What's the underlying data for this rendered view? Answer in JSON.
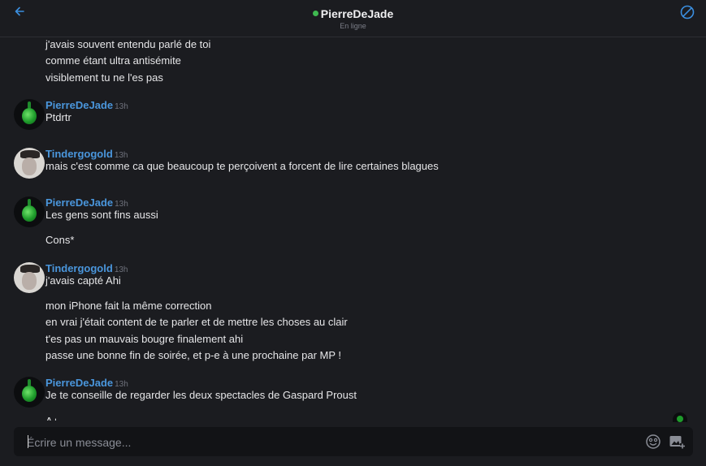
{
  "header": {
    "title": "PierreDeJade",
    "status": "En ligne",
    "status_color": "#3fb950",
    "back_icon": "arrow-left-icon",
    "block_icon": "block-icon"
  },
  "messages": {
    "orphan_lines": [
      "j'avais souvent entendu parlé de toi",
      "comme étant ultra antisémite",
      "visiblement tu ne l'es pas"
    ],
    "groups": [
      {
        "author": "PierreDeJade",
        "time": "13h",
        "lines": [
          "Ptdrtr"
        ]
      },
      {
        "author": "Tindergogold",
        "time": "13h",
        "lines": [
          "mais c'est comme ca que beaucoup te perçoivent a forcent de lire certaines blagues"
        ]
      },
      {
        "author": "PierreDeJade",
        "time": "13h",
        "lines": [
          "Les gens sont fins aussi",
          "Cons*"
        ]
      },
      {
        "author": "Tindergogold",
        "time": "13h",
        "lines": [
          "j'avais capté Ahi",
          "mon iPhone fait la même correction",
          "en vrai j'était content de te parler et de mettre les choses au clair",
          "t'es pas un mauvais bougre finalement ahi",
          "passe une bonne fin de soirée, et p-e à une prochaine par MP !"
        ]
      },
      {
        "author": "PierreDeJade",
        "time": "13h",
        "lines": [
          "Je te conseille de regarder les deux spectacles de Gaspard Proust",
          "A+"
        ]
      }
    ]
  },
  "composer": {
    "placeholder": "Écrire un message...",
    "value": "",
    "emoji_icon": "emoji-icon",
    "image_icon": "add-image-icon"
  },
  "colors": {
    "background": "#1b1c20",
    "author": "#4a96dc",
    "accent": "#3b8fe0"
  }
}
